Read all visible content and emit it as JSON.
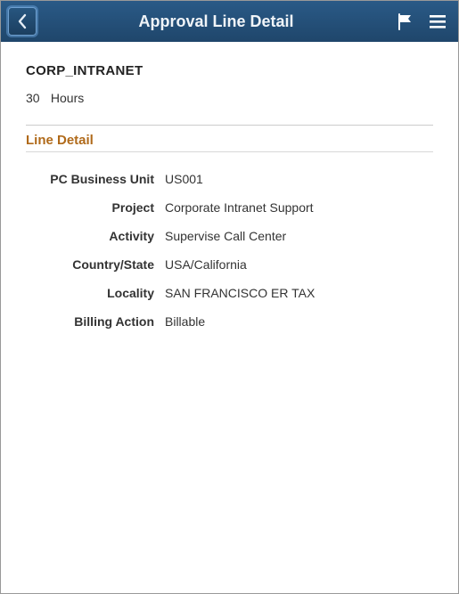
{
  "header": {
    "title": "Approval Line Detail"
  },
  "summary": {
    "code": "CORP_INTRANET",
    "quantity": "30",
    "unit": "Hours"
  },
  "section": {
    "title": "Line Detail"
  },
  "details": [
    {
      "label": "PC Business Unit",
      "value": "US001"
    },
    {
      "label": "Project",
      "value": "Corporate Intranet Support"
    },
    {
      "label": "Activity",
      "value": "Supervise Call Center"
    },
    {
      "label": "Country/State",
      "value": "USA/California"
    },
    {
      "label": "Locality",
      "value": "SAN FRANCISCO ER TAX"
    },
    {
      "label": "Billing Action",
      "value": "Billable"
    }
  ]
}
